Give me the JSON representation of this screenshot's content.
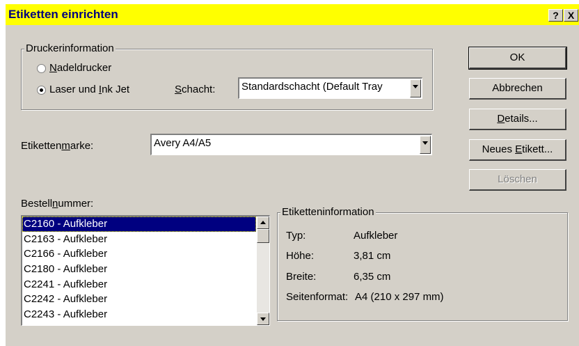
{
  "window": {
    "title": "Etiketten einrichten",
    "help_label": "?",
    "close_label": "X"
  },
  "printer_info": {
    "legend": "Druckerinformation",
    "option_dot_matrix": "Nadeldrucker",
    "option_laser": "Laser und Ink Jet",
    "selected": "Laser und Ink Jet",
    "tray_label": "Schacht:",
    "tray_value": "Standardschacht (Default Tray"
  },
  "label_brand": {
    "label": "Etikettenmarke:",
    "value": "Avery A4/A5"
  },
  "order_number": {
    "label": "Bestellnummer:",
    "items": [
      "C2160 - Aufkleber",
      "C2163 - Aufkleber",
      "C2166 - Aufkleber",
      "C2180 - Aufkleber",
      "C2241 - Aufkleber",
      "C2242 - Aufkleber",
      "C2243 - Aufkleber"
    ],
    "selected": "C2160 - Aufkleber"
  },
  "label_info": {
    "legend": "Etiketteninformation",
    "type_label": "Typ:",
    "type_value": "Aufkleber",
    "height_label": "Höhe:",
    "height_value": "3,81 cm",
    "width_label": "Breite:",
    "width_value": "6,35 cm",
    "page_size_label": "Seitenformat:",
    "page_size_value": "A4 (210 x 297 mm)"
  },
  "buttons": {
    "ok": "OK",
    "cancel": "Abbrechen",
    "details": "Details...",
    "new_label": "Neues Etikett...",
    "delete": "Löschen"
  },
  "colors": {
    "title_bar": "#ffff00",
    "title_text": "#000080",
    "dialog_face": "#d4d0c8",
    "selection": "#000080"
  }
}
